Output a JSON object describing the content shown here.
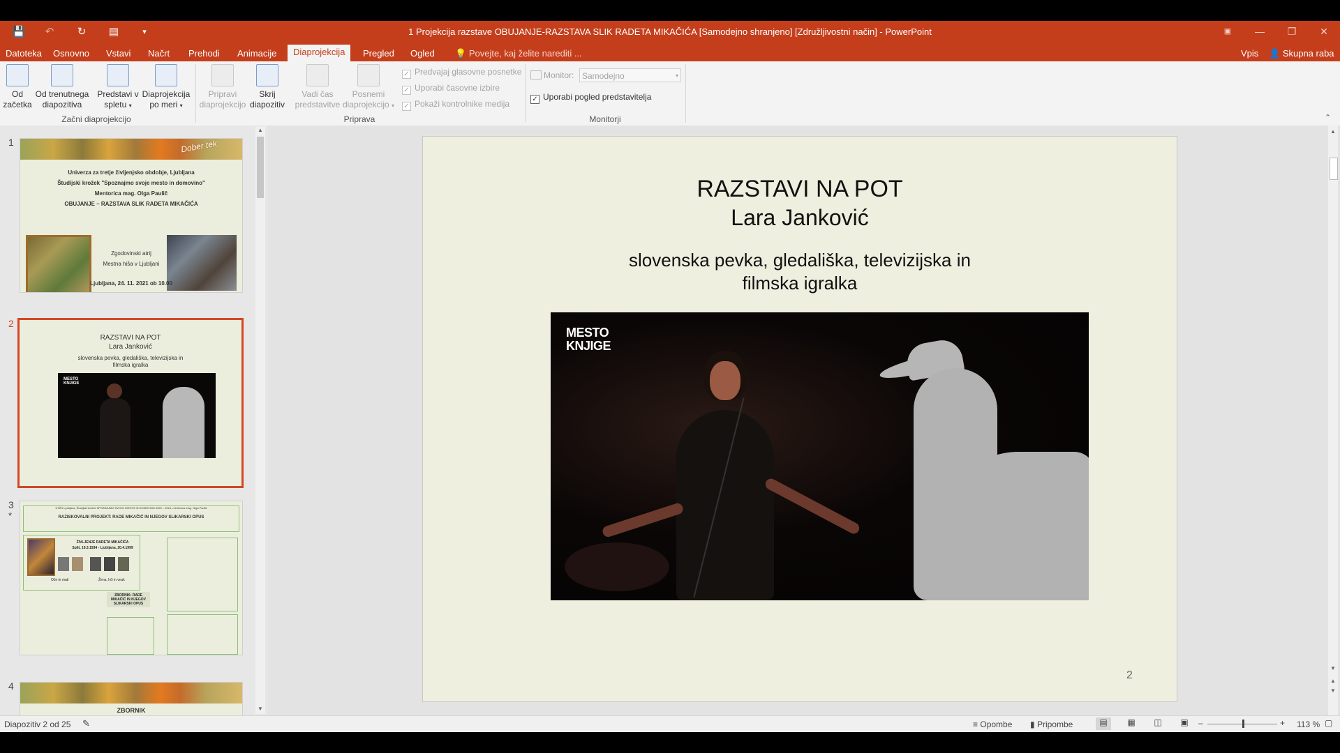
{
  "window": {
    "title": "1 Projekcija razstave OBUJANJE-RAZSTAVA SLIK RADETA MIKAČIĆA [Samodejno shranjeno] [Združljivostni način] - PowerPoint",
    "accent_color": "#c43e1c"
  },
  "tabs": [
    "Datoteka",
    "Osnovno",
    "Vstavi",
    "Načrt",
    "Prehodi",
    "Animacije",
    "Diaprojekcija",
    "Pregled",
    "Ogled"
  ],
  "tell_me": "Povejte, kaj želite narediti ...",
  "account": {
    "signin": "Vpis",
    "share": "Skupna raba"
  },
  "ribbon": {
    "group_start": {
      "label": "Začni diaprojekcijo",
      "from_start": "Od začetka",
      "from_current": "Od trenutnega diapozitiva",
      "present_online": "Predstavi v spletu",
      "custom_show": "Diaprojekcija po meri"
    },
    "group_setup": {
      "label": "Priprava",
      "setup_show": "Pripravi diaprojekcijo",
      "hide_slide": "Skrij diapozitiv",
      "rehearse": "Vadi čas predstavitve",
      "record": "Posnemi diaprojekcijo",
      "play_narrations": "Predvajaj glasovne posnetke",
      "use_timings": "Uporabi časovne izbire",
      "show_media_controls": "Pokaži kontrolnike medija"
    },
    "group_monitors": {
      "label": "Monitorji",
      "monitor_label": "Monitor:",
      "monitor_value": "Samodejno",
      "presenter_view": "Uporabi pogled predstavitelja"
    }
  },
  "thumbnails": {
    "numbers": [
      "1",
      "2",
      "3",
      "4"
    ],
    "t1": {
      "line1": "Univerza za tretje življenjsko obdobje, Ljubljana",
      "line2": "Študijski krožek \"Spoznajmo svoje mesto in domovino\"",
      "line3": "Mentorica mag. Olga Paulič",
      "line4": "OBUJANJE – RAZSTAVA SLIK RADETA MIKAČIĆA",
      "place1": "Zgodovinski atrij",
      "place2": "Mestna hiša v Ljubljani",
      "date": "Ljubljana, 24. 11. 2021 ob 10.00",
      "stamp": "Dober tek"
    },
    "t2": {
      "title1": "RAZSTAVI NA POT",
      "title2": "Lara Janković",
      "sub1": "slovenska pevka, gledališka, televizijska in",
      "sub2": "filmska igralka"
    },
    "t3": {
      "header": "UTŽO Ljubljana, Študijski krožek SPOZNAJMO SVOJO MESTO IN DOMOVINO 2020 – 2021, mentorica mag. Olga Paulič",
      "project": "RAZISKOVALNI PROJEKT: RADE MIKAČIĆ IN NJEGOV SLIKARSKI OPUS",
      "bio1": "ŽIVLJENJE RADETA MIKAČIĆA",
      "bio2": "Split, 19.3.1934 - Ljubljana, 20.4.1999",
      "parents": "Oče in mati",
      "wife": "Žena, hči in vnuk",
      "zbornik": "ZBORNIK: RADE MIKAČIĆ IN NJEGOV SLIKARSKI OPUS",
      "star": "*"
    },
    "t4": {
      "label": "ZBORNIK"
    }
  },
  "slide": {
    "title1": "RAZSTAVI NA POT",
    "title2": "Lara Janković",
    "subtitle1": "slovenska pevka, gledališka, televizijska in",
    "subtitle2": "filmska igralka",
    "logo1": "MESTO",
    "logo2": "KNJIGE",
    "page_number": "2",
    "background": "#eeefdf"
  },
  "status": {
    "slide_info": "Diapozitiv 2 od 25",
    "notes": "Opombe",
    "comments": "Pripombe",
    "zoom": "113 %"
  }
}
